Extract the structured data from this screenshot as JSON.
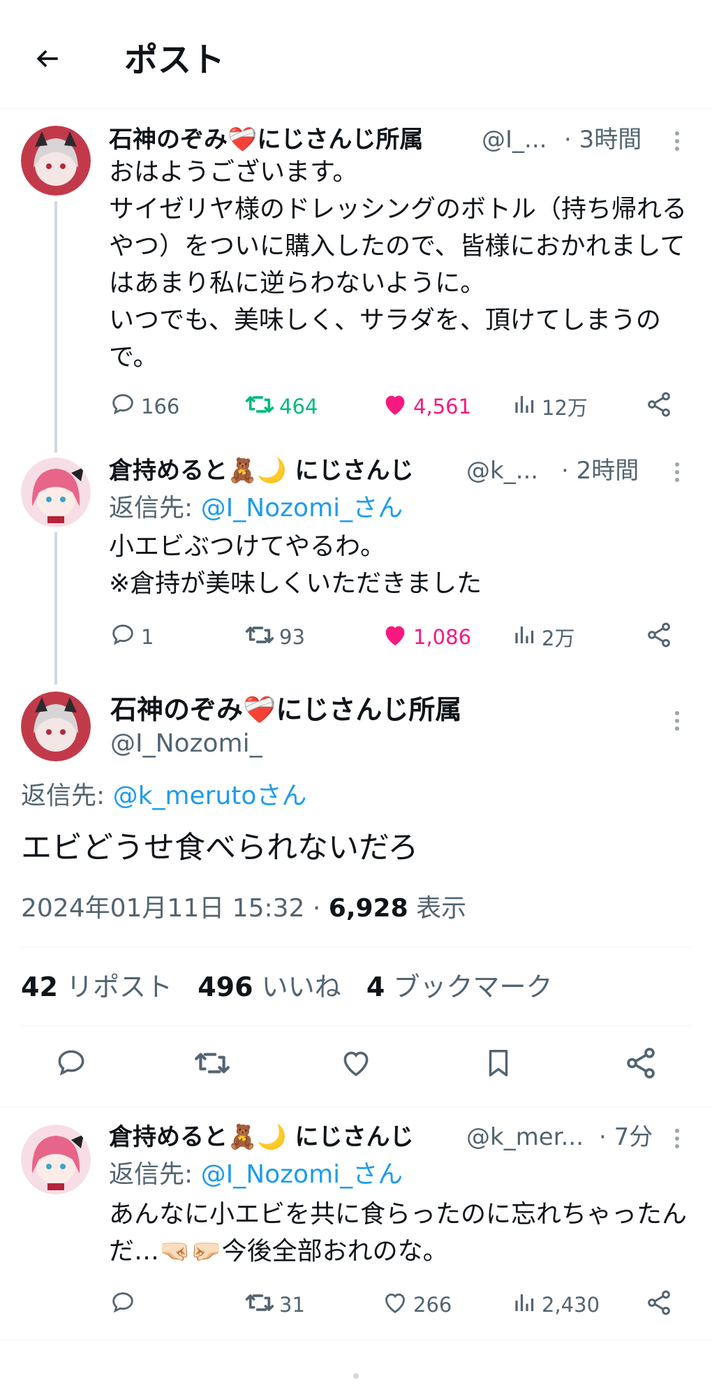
{
  "header": {
    "title": "ポスト"
  },
  "tweet1": {
    "name": "石神のぞみ❤️‍🩹にじさんじ所属",
    "handle": "@I_...",
    "time": "· 3時間",
    "text": "おはようございます。\nサイゼリヤ様のドレッシングのボトル（持ち帰れるやつ）をついに購入したので、皆様におかれましてはあまり私に逆らわないように。\nいつでも、美味しく、サラダを、頂けてしまうので。",
    "replies": "166",
    "reposts": "464",
    "likes": "4,561",
    "views": "12万"
  },
  "tweet2": {
    "name": "倉持めると🧸🌙 にじさんじ",
    "handle": "@k_...",
    "time": "· 2時間",
    "reply_prefix": "返信先: ",
    "reply_to": "@I_Nozomi_さん",
    "text": "小エビぶつけてやるわ。\n※倉持が美味しくいただきました",
    "replies": "1",
    "reposts": "93",
    "likes": "1,086",
    "views": "2万"
  },
  "main": {
    "name": "石神のぞみ❤️‍🩹にじさんじ所属",
    "handle": "@I_Nozomi_",
    "reply_prefix": "返信先: ",
    "reply_to": "@k_merutoさん",
    "text": "エビどうせ食べられないだろ",
    "datetime": "2024年01月11日 15:32 · ",
    "views": "6,928",
    "views_label": " 表示",
    "reposts": "42",
    "reposts_label": " リポスト",
    "likes": "496",
    "likes_label": " いいね",
    "bookmarks": "4",
    "bookmarks_label": " ブックマーク"
  },
  "tweet3": {
    "name": "倉持めると🧸🌙 にじさんじ",
    "handle": "@k_mer...",
    "time": "· 7分",
    "reply_prefix": "返信先: ",
    "reply_to": "@I_Nozomi_さん",
    "text": "あんなに小エビを共に食らったのに忘れちゃったんだ…🤜🏻🤛🏻今後全部おれのな。",
    "replies": "",
    "reposts": "31",
    "likes": "266",
    "views": "2,430"
  },
  "colors": {
    "accent": "#1d9bf0",
    "repost_green": "#00ba7c",
    "like_pink": "#f91880",
    "muted": "#536471"
  }
}
